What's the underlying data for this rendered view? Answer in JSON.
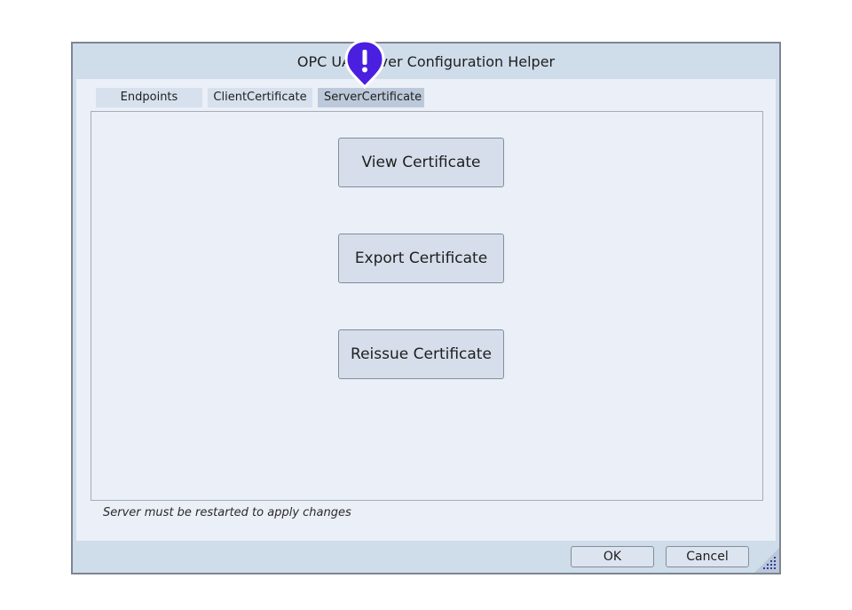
{
  "window": {
    "title": "OPC UA Server Configuration Helper"
  },
  "tabs": [
    {
      "label": "Endpoints",
      "active": false
    },
    {
      "label": "ClientCertificate",
      "active": false
    },
    {
      "label": "ServerCertificate",
      "active": true
    }
  ],
  "server_certificate_panel": {
    "view_label": "View Certificate",
    "export_label": "Export Certificate",
    "reissue_label": "Reissue Certificate"
  },
  "footer": {
    "note": "Server must be restarted to apply changes",
    "ok_label": "OK",
    "cancel_label": "Cancel"
  },
  "overlay": {
    "alert_glyph": "!",
    "alert_icon": "exclamation-pin-icon",
    "accent_color": "#4a1fe0"
  }
}
